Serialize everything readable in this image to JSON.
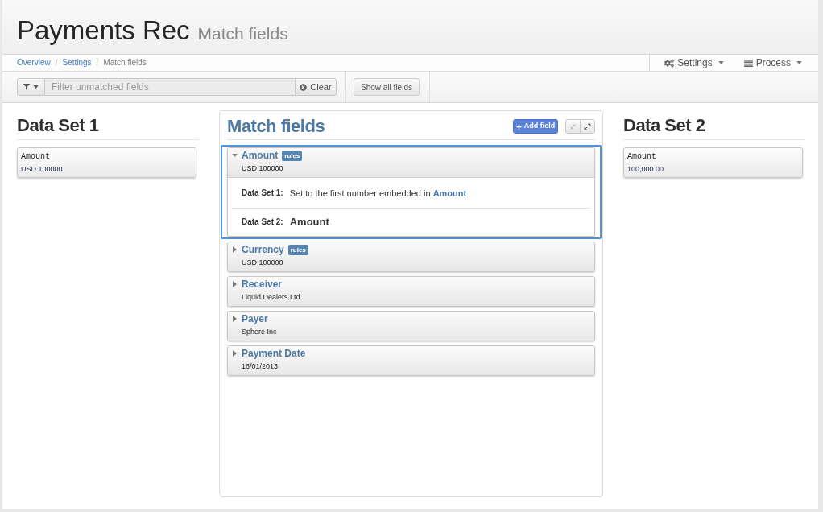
{
  "header": {
    "title": "Payments Rec",
    "subtitle": "Match fields"
  },
  "breadcrumb": {
    "separator": "/",
    "items": [
      {
        "label": "Overview",
        "current": false
      },
      {
        "label": "Settings",
        "current": false
      },
      {
        "label": "Match fields",
        "current": true
      }
    ]
  },
  "settings_menu": {
    "label": "Settings"
  },
  "process_menu": {
    "label": "Process"
  },
  "toolbar": {
    "filter": {
      "placeholder": "Filter unmatched fields"
    },
    "clear_button": {
      "label": "Clear"
    },
    "show_all_button": {
      "label": "Show all fields"
    }
  },
  "data_set_1": {
    "title": "Data Set 1",
    "fields": [
      {
        "name": "Amount",
        "value": "USD 100000"
      }
    ]
  },
  "match_panel": {
    "title": "Match fields",
    "add_button": {
      "label": "Add field"
    },
    "view_buttons": [
      {
        "kind": "collapse",
        "disabled": true
      },
      {
        "kind": "expand",
        "disabled": false
      }
    ],
    "fields": [
      {
        "name": "Amount",
        "badge": "rules",
        "value": "USD 100000",
        "expanded": true,
        "selected": true,
        "mappings": [
          {
            "label": "Data Set 1:",
            "kind": "rule",
            "text": "Set to the first number embedded in **Amount**"
          },
          {
            "label": "Data Set 2:",
            "kind": "field",
            "text": "Amount"
          }
        ]
      },
      {
        "name": "Currency",
        "badge": "rules",
        "value": "USD 100000",
        "expanded": false,
        "selected": false
      },
      {
        "name": "Receiver",
        "value": "Liquid Dealers Ltd",
        "expanded": false,
        "selected": false
      },
      {
        "name": "Payer",
        "value": "Sphere Inc",
        "expanded": false,
        "selected": false
      },
      {
        "name": "Payment Date",
        "value": "16/01/2013",
        "expanded": false,
        "selected": false
      }
    ]
  },
  "data_set_2": {
    "title": "Data Set 2",
    "fields": [
      {
        "name": "Amount",
        "value": "100,000.00"
      }
    ]
  }
}
